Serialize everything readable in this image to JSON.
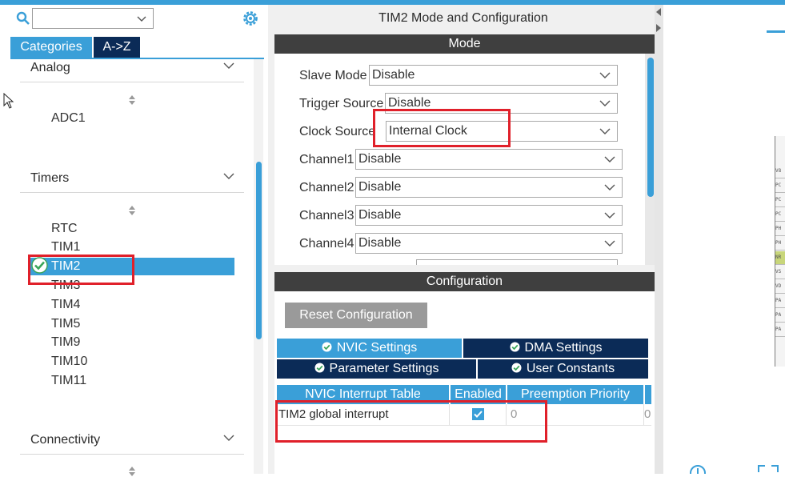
{
  "left_panel": {
    "tabs": {
      "categories": "Categories",
      "az": "A->Z"
    },
    "groups": [
      {
        "label": "Analog",
        "items": [
          "ADC1"
        ]
      },
      {
        "label": "Timers",
        "items": [
          "RTC",
          "TIM1",
          "TIM2",
          "TIM3",
          "TIM4",
          "TIM5",
          "TIM9",
          "TIM10",
          "TIM11"
        ]
      },
      {
        "label": "Connectivity",
        "items": []
      }
    ],
    "selected_item": "TIM2"
  },
  "mode_panel": {
    "title": "TIM2 Mode and Configuration",
    "mode_header": "Mode",
    "fields": [
      {
        "label": "Slave Mode",
        "value": "Disable"
      },
      {
        "label": "Trigger Source",
        "value": "Disable"
      },
      {
        "label": "Clock Source",
        "value": "Internal Clock"
      },
      {
        "label": "Channel1",
        "value": "Disable"
      },
      {
        "label": "Channel2",
        "value": "Disable"
      },
      {
        "label": "Channel3",
        "value": "Disable"
      },
      {
        "label": "Channel4",
        "value": "Disable"
      }
    ]
  },
  "config_panel": {
    "header": "Configuration",
    "reset_button": "Reset Configuration",
    "tabs": [
      {
        "label": "NVIC Settings",
        "active": true
      },
      {
        "label": "DMA Settings",
        "active": false
      },
      {
        "label": "Parameter Settings",
        "active": false
      },
      {
        "label": "User Constants",
        "active": false
      }
    ],
    "table": {
      "columns": [
        "NVIC Interrupt Table",
        "Enabled",
        "Preemption Priority"
      ],
      "rows": [
        {
          "name": "TIM2 global interrupt",
          "enabled": true,
          "preemption": "0",
          "sub": "0"
        }
      ]
    }
  },
  "chip_pins": [
    "V8",
    "PC",
    "PC",
    "PC",
    "PH",
    "PH",
    "NR",
    "VS",
    "VD",
    "PA",
    "PA",
    "PA"
  ],
  "colors": {
    "accent": "#3a9fd8",
    "dark": "#0b2b57",
    "highlight_box": "#e0202a",
    "pin_green": "#c8d67a"
  }
}
